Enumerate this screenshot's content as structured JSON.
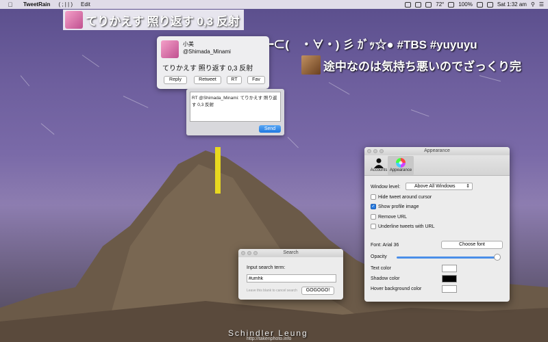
{
  "menubar": {
    "app_name": "TweetRain",
    "menu_emote": "( ; | | )",
    "menu_edit": "Edit",
    "battery": "100%",
    "temperature": "72°",
    "clock": "Sat 1:32 am"
  },
  "tweets": {
    "banner1": "てりかえす 照り返す 0,3 反射",
    "banner2": "■━⊂(　・∀・) 彡 ｶﾞｯ☆● #TBS #yuyuyu",
    "banner3": "途中なのは気持ち悪いのでざっくり完"
  },
  "popover": {
    "name": "小美",
    "handle": "@Shimada_Minami",
    "text": "てりかえす 照り返す 0,3 反射",
    "reply": "Reply",
    "retweet": "Retweet",
    "rt": "RT",
    "fav": "Fav"
  },
  "reply_panel": {
    "text": "RT @Shimada_Minami: てりかえす 照り返す 0,3 反射",
    "send": "Send"
  },
  "search_window": {
    "title": "Search",
    "label": "Input search term:",
    "value": "#umhk",
    "hint": "Leave this blank to cancel search",
    "go": "GOGOGO!"
  },
  "appearance": {
    "title": "Appearance",
    "tab_accounts": "Accounts",
    "tab_appearance": "Appearance",
    "window_level_label": "Window level:",
    "window_level_value": "Above All Windows",
    "hide_tweet": "Hide tweet around cursor",
    "show_profile": "Show profile image",
    "remove_url": "Remove URL",
    "underline": "Underline tweets with URL",
    "font_label": "Font: Arial 36",
    "choose_font": "Choose font",
    "opacity": "Opacity",
    "opacity_value": 0.97,
    "text_color": "Text color",
    "shadow_color": "Shadow color",
    "hover_bg_color": "Hover background color"
  },
  "credit": {
    "name": "Schindler Leung",
    "url": "http://takenphoto.info"
  }
}
